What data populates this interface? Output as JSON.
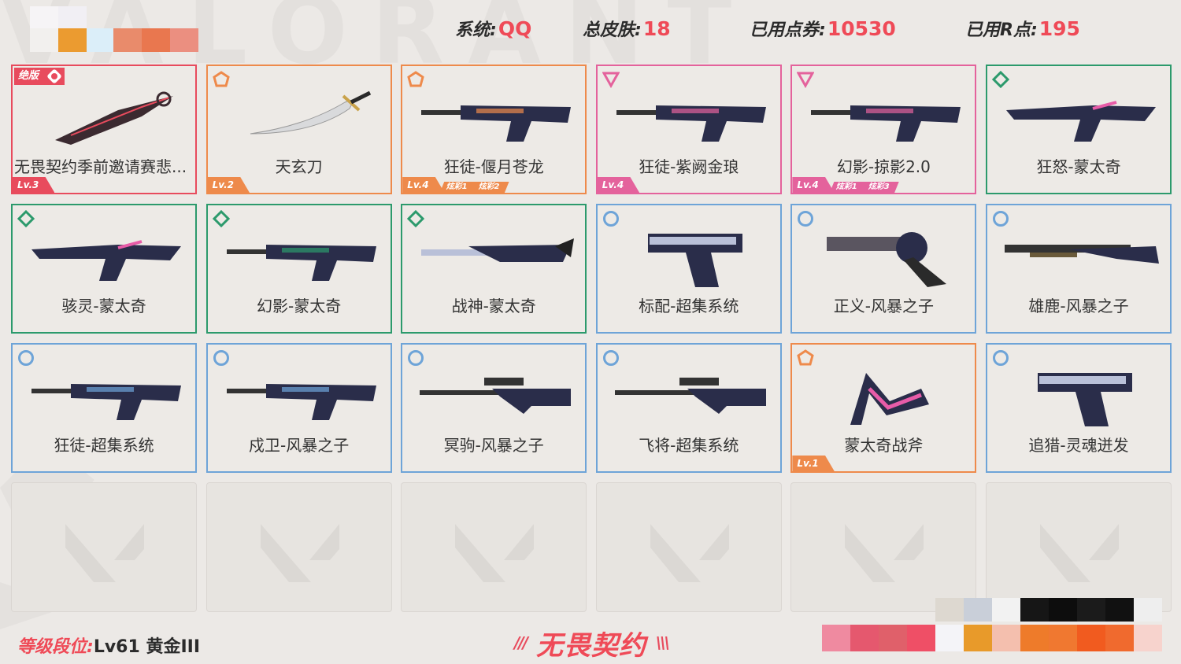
{
  "header": {
    "stats": [
      {
        "label": "系统:",
        "value": "QQ"
      },
      {
        "label": "总皮肤:",
        "value": "18"
      },
      {
        "label": "已用点券:",
        "value": "10530"
      },
      {
        "label": "已用R点:",
        "value": "195"
      }
    ],
    "background_text": "VALORANT"
  },
  "colors": {
    "accent": "#ef4a57",
    "tier_red": "#e84b5d",
    "tier_orange": "#ee8a4b",
    "tier_pink": "#e4629c",
    "tier_green": "#2c9a6c",
    "tier_blue": "#6ea4d8"
  },
  "skins": [
    {
      "name": "无畏契约季前邀请赛悲...",
      "tier": "red",
      "tier_icon": "limited-edition-icon",
      "badge": "绝版",
      "level": "Lv.3",
      "chromas": [],
      "weapon_icon": "knife-icon"
    },
    {
      "name": "天玄刀",
      "tier": "orange",
      "tier_icon": "pentagon-tier-icon",
      "level": "Lv.2",
      "chromas": [],
      "weapon_icon": "sword-icon"
    },
    {
      "name": "狂徒-偃月苍龙",
      "tier": "orange",
      "tier_icon": "pentagon-tier-icon",
      "level": "Lv.4",
      "chromas": [
        "炫彩1",
        "炫彩2"
      ],
      "weapon_icon": "rifle-icon"
    },
    {
      "name": "狂徒-紫阙金琅",
      "tier": "pink",
      "tier_icon": "triangle-tier-icon",
      "level": "Lv.4",
      "chromas": [],
      "weapon_icon": "rifle-icon"
    },
    {
      "name": "幻影-掠影2.0",
      "tier": "pink",
      "tier_icon": "triangle-tier-icon",
      "level": "Lv.4",
      "chromas": [
        "炫彩1",
        "炫彩3"
      ],
      "weapon_icon": "rifle-icon"
    },
    {
      "name": "狂怒-蒙太奇",
      "tier": "green",
      "tier_icon": "diamond-tier-icon",
      "level": "",
      "chromas": [],
      "weapon_icon": "smg-icon"
    },
    {
      "name": "骇灵-蒙太奇",
      "tier": "green",
      "tier_icon": "diamond-tier-icon",
      "level": "",
      "chromas": [],
      "weapon_icon": "smg-icon"
    },
    {
      "name": "幻影-蒙太奇",
      "tier": "green",
      "tier_icon": "diamond-tier-icon",
      "level": "",
      "chromas": [],
      "weapon_icon": "rifle-icon"
    },
    {
      "name": "战神-蒙太奇",
      "tier": "green",
      "tier_icon": "diamond-tier-icon",
      "level": "",
      "chromas": [],
      "weapon_icon": "lmg-icon"
    },
    {
      "name": "标配-超集系统",
      "tier": "blue",
      "tier_icon": "circle-tier-icon",
      "level": "",
      "chromas": [],
      "weapon_icon": "pistol-icon"
    },
    {
      "name": "正义-风暴之子",
      "tier": "blue",
      "tier_icon": "circle-tier-icon",
      "level": "",
      "chromas": [],
      "weapon_icon": "revolver-icon"
    },
    {
      "name": "雄鹿-风暴之子",
      "tier": "blue",
      "tier_icon": "circle-tier-icon",
      "level": "",
      "chromas": [],
      "weapon_icon": "shotgun-icon"
    },
    {
      "name": "狂徒-超集系统",
      "tier": "blue",
      "tier_icon": "circle-tier-icon",
      "level": "",
      "chromas": [],
      "weapon_icon": "rifle-icon"
    },
    {
      "name": "戍卫-风暴之子",
      "tier": "blue",
      "tier_icon": "circle-tier-icon",
      "level": "",
      "chromas": [],
      "weapon_icon": "rifle-icon"
    },
    {
      "name": "冥驹-风暴之子",
      "tier": "blue",
      "tier_icon": "circle-tier-icon",
      "level": "",
      "chromas": [],
      "weapon_icon": "sniper-icon"
    },
    {
      "name": "飞将-超集系统",
      "tier": "blue",
      "tier_icon": "circle-tier-icon",
      "level": "",
      "chromas": [],
      "weapon_icon": "sniper-icon"
    },
    {
      "name": "蒙太奇战斧",
      "tier": "orange",
      "tier_icon": "pentagon-tier-icon",
      "level": "Lv.1",
      "chromas": [],
      "weapon_icon": "axe-icon"
    },
    {
      "name": "追猎-灵魂迸发",
      "tier": "blue",
      "tier_icon": "circle-tier-icon",
      "level": "",
      "chromas": [],
      "weapon_icon": "pistol-icon"
    }
  ],
  "empty_slots": 6,
  "footer": {
    "rank_label": "等级段位:",
    "rank_value": "Lv61  黄金III",
    "game_title": "无畏契约",
    "left_slashes": "///",
    "right_slashes": "\\\\\\"
  }
}
